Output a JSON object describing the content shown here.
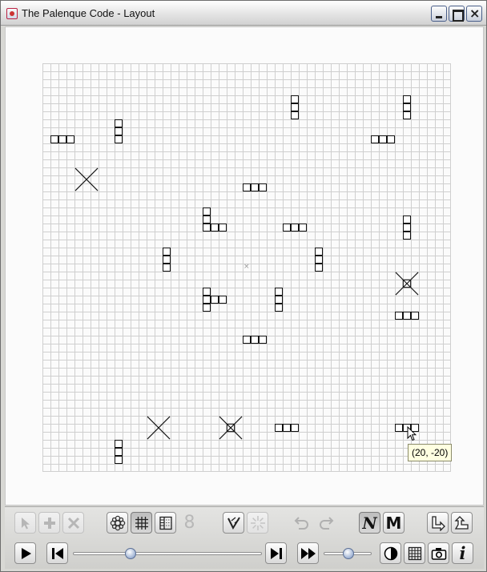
{
  "window": {
    "title": "The Palenque Code - Layout",
    "controls": [
      "minimize-icon",
      "maximize-icon",
      "close-icon"
    ],
    "close_glyph": "×"
  },
  "board": {
    "origin_marker": "×",
    "pieces": [
      {
        "type": "bar-horizontal",
        "cells": 3
      },
      {
        "type": "bar-vertical",
        "cells": 3
      },
      {
        "type": "x-mark",
        "boxed": false
      },
      {
        "type": "bar-vertical",
        "cells": 3
      },
      {
        "type": "bar-horizontal",
        "cells": 3
      },
      {
        "type": "l-shape",
        "cells": 4
      },
      {
        "type": "bar-horizontal",
        "cells": 3
      },
      {
        "type": "bar-vertical",
        "cells": 3
      },
      {
        "type": "bar-vertical",
        "cells": 3
      },
      {
        "type": "t-shape",
        "cells": 4
      },
      {
        "type": "bar-vertical",
        "cells": 3
      },
      {
        "type": "bar-horizontal",
        "cells": 3
      },
      {
        "type": "bar-vertical",
        "cells": 3
      },
      {
        "type": "bar-horizontal",
        "cells": 3
      },
      {
        "type": "bar-vertical",
        "cells": 3
      },
      {
        "type": "x-mark",
        "boxed": true
      },
      {
        "type": "bar-horizontal",
        "cells": 3
      },
      {
        "type": "x-mark",
        "boxed": false
      },
      {
        "type": "x-mark",
        "boxed": true
      },
      {
        "type": "bar-horizontal",
        "cells": 3
      },
      {
        "type": "bar-horizontal",
        "cells": 3
      },
      {
        "type": "bar-vertical",
        "cells": 3
      }
    ]
  },
  "tooltip": {
    "text": "(20, -20)"
  },
  "toolbar": {
    "row1": [
      {
        "icon": "select-arrow-icon",
        "enabled": false
      },
      {
        "icon": "add-plus-icon",
        "enabled": false
      },
      {
        "icon": "delete-x-icon",
        "enabled": false
      },
      {
        "icon": "gear-flower-icon",
        "enabled": true
      },
      {
        "icon": "grid-icon",
        "enabled": true,
        "pressed": true
      },
      {
        "icon": "dotted-grid-icon",
        "enabled": true
      },
      {
        "icon": "digit-eight-icon",
        "label": "8",
        "enabled": false
      },
      {
        "icon": "check-lines-icon",
        "enabled": true
      },
      {
        "icon": "sparkle-icon",
        "enabled": false
      },
      {
        "icon": "undo-icon",
        "enabled": false
      },
      {
        "icon": "redo-icon",
        "enabled": false
      },
      {
        "icon": "letter-n-icon",
        "label": "N",
        "enabled": true,
        "pressed": true
      },
      {
        "icon": "letter-m-icon",
        "label": "M",
        "enabled": true
      },
      {
        "icon": "rotate-right-icon",
        "enabled": true
      },
      {
        "icon": "rotate-up-icon",
        "enabled": true
      }
    ],
    "row2": [
      {
        "icon": "play-icon"
      },
      {
        "icon": "skip-to-start-icon"
      },
      {
        "icon": "skip-to-end-icon"
      },
      {
        "icon": "fast-forward-icon"
      },
      {
        "icon": "contrast-icon"
      },
      {
        "icon": "table-grid-icon"
      },
      {
        "icon": "camera-icon"
      },
      {
        "icon": "info-icon",
        "label": "i"
      }
    ],
    "timeline_slider": {
      "value": 0.29
    },
    "speed_slider": {
      "value": 0.5
    }
  }
}
